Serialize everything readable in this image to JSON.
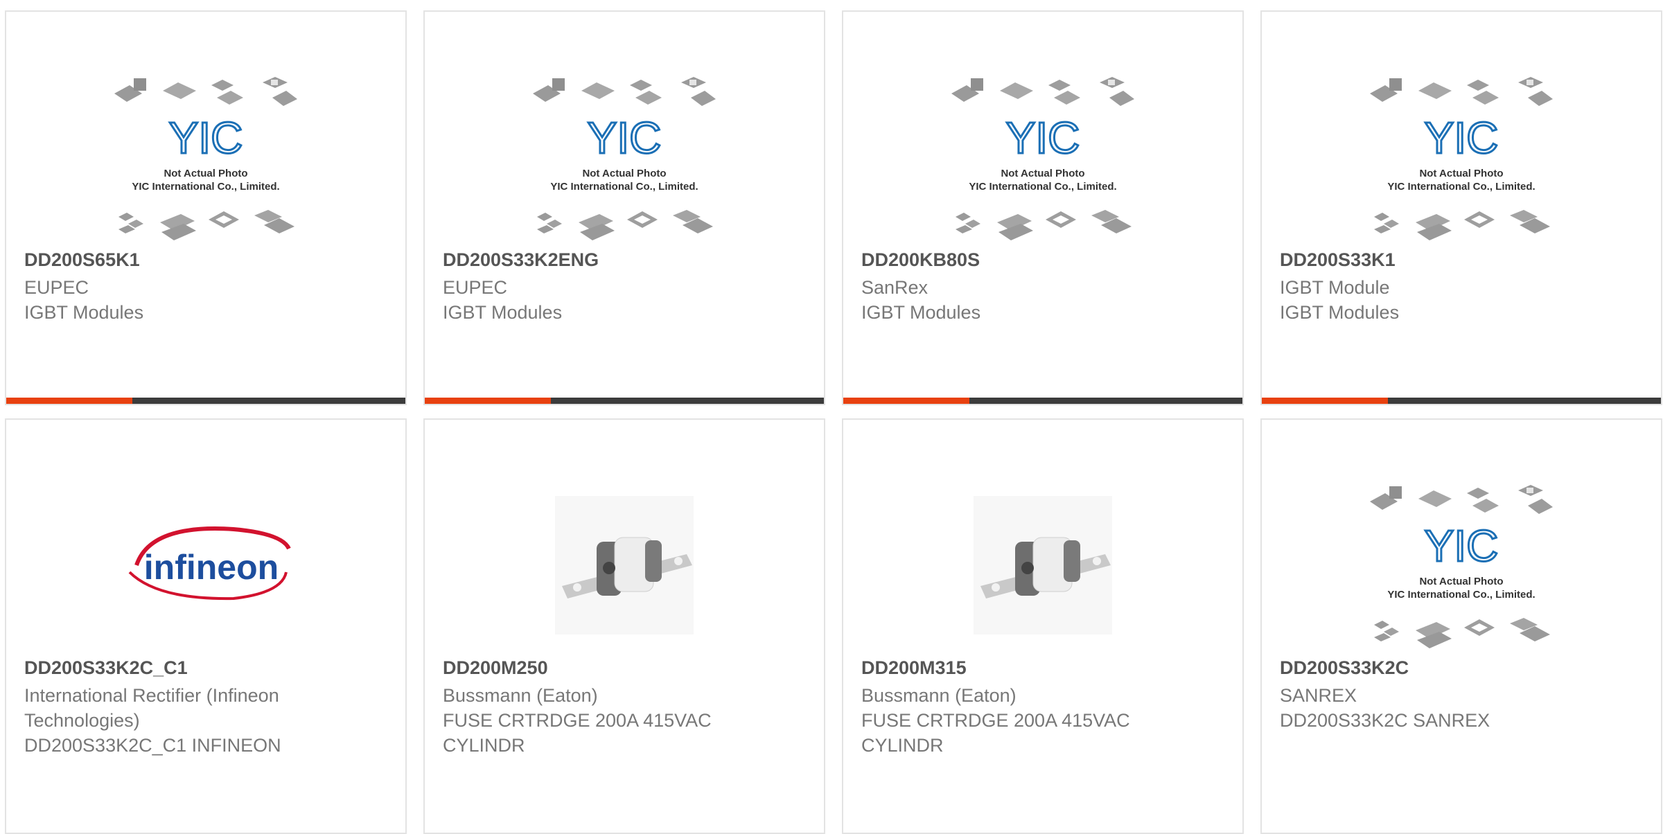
{
  "products": [
    {
      "part": "DD200S65K1",
      "line1": "EUPEC",
      "line2": "IGBT Modules",
      "line3": "",
      "image": "yic-placeholder",
      "caption1": "Not Actual Photo",
      "caption2": "YIC International Co., Limited.",
      "logo_text": "YIC"
    },
    {
      "part": "DD200S33K2ENG",
      "line1": "EUPEC",
      "line2": "IGBT Modules",
      "line3": "",
      "image": "yic-placeholder",
      "caption1": "Not Actual Photo",
      "caption2": "YIC International Co., Limited.",
      "logo_text": "YIC"
    },
    {
      "part": "DD200KB80S",
      "line1": "SanRex",
      "line2": "IGBT Modules",
      "line3": "",
      "image": "yic-placeholder",
      "caption1": "Not Actual Photo",
      "caption2": "YIC International Co., Limited.",
      "logo_text": "YIC"
    },
    {
      "part": "DD200S33K1",
      "line1": "IGBT Module",
      "line2": "IGBT Modules",
      "line3": "",
      "image": "yic-placeholder",
      "caption1": "Not Actual Photo",
      "caption2": "YIC International Co., Limited.",
      "logo_text": "YIC"
    },
    {
      "part": "DD200S33K2C_C1",
      "line1": "International Rectifier (Infineon",
      "line2": "Technologies)",
      "line3": "DD200S33K2C_C1 INFINEON",
      "image": "infineon-logo",
      "logo_text": "infineon"
    },
    {
      "part": "DD200M250",
      "line1": "Bussmann (Eaton)",
      "line2": "FUSE CRTRDGE 200A 415VAC",
      "line3": "CYLINDR",
      "image": "fuse-photo"
    },
    {
      "part": "DD200M315",
      "line1": "Bussmann (Eaton)",
      "line2": "FUSE CRTRDGE 200A 415VAC",
      "line3": "CYLINDR",
      "image": "fuse-photo"
    },
    {
      "part": "DD200S33K2C",
      "line1": "SANREX",
      "line2": "DD200S33K2C SANREX",
      "line3": "",
      "image": "yic-placeholder",
      "caption1": "Not Actual Photo",
      "caption2": "YIC International Co., Limited.",
      "logo_text": "YIC"
    }
  ],
  "colors": {
    "accent": "#e8410f",
    "bar": "#3c3c3c",
    "title": "#555555",
    "text": "#777777",
    "yic_blue": "#1b6fb5",
    "infineon_red": "#d2122e",
    "infineon_blue": "#1d4e9e"
  }
}
